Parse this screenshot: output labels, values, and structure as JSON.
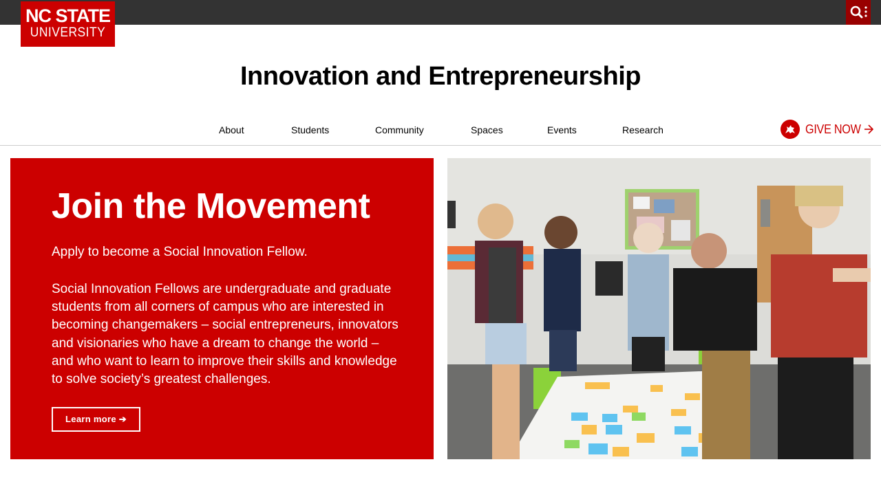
{
  "logo": {
    "line1": "NC STATE",
    "line2": "UNIVERSITY"
  },
  "search": {
    "icon": "search-icon"
  },
  "site_title": "Innovation and Entrepreneurship",
  "nav": [
    {
      "label": "About"
    },
    {
      "label": "Students"
    },
    {
      "label": "Community"
    },
    {
      "label": "Spaces"
    },
    {
      "label": "Events"
    },
    {
      "label": "Research"
    }
  ],
  "give": {
    "label": "GIVE NOW",
    "icon": "wolf-icon"
  },
  "hero": {
    "title": "Join the Movement",
    "subtitle": "Apply to become a Social Innovation Fellow.",
    "body": "Social Innovation Fellows are undergraduate and graduate students from all corners of campus who are interested in becoming changemakers – social entrepreneurs, innovators and visionaries who have a dream to change the world – and who want to learn to improve their skills and knowledge to solve society’s greatest challenges.",
    "button_label": "Learn more ➔"
  },
  "colors": {
    "brand_red": "#cc0000",
    "dark_red": "#990000",
    "topbar": "#333333"
  }
}
